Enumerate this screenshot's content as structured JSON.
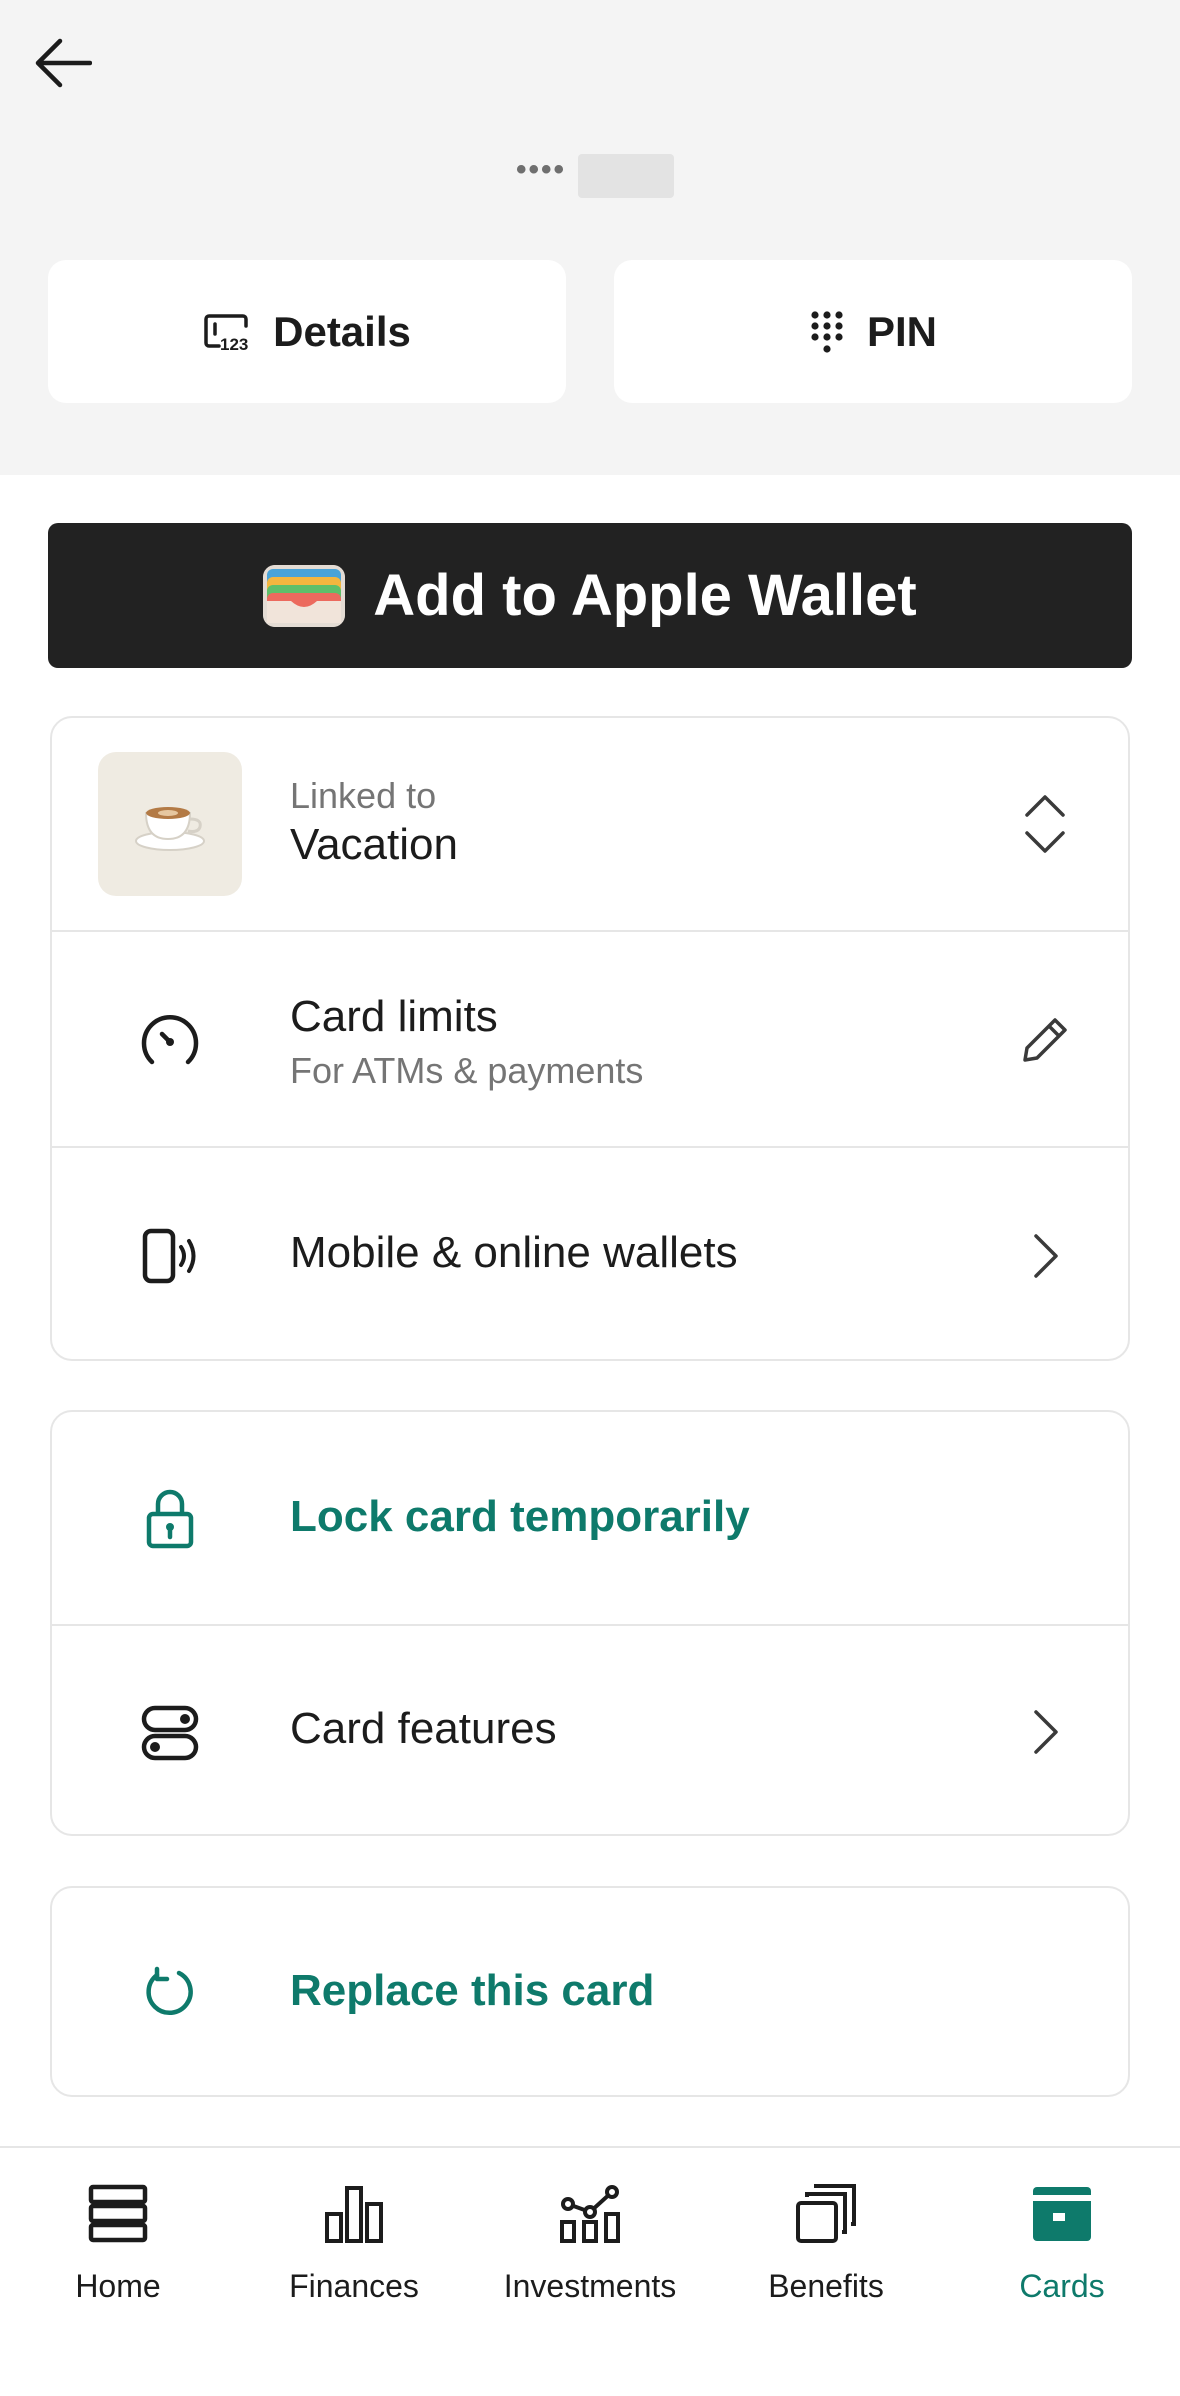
{
  "header": {
    "back_icon": "arrow-left-icon",
    "card_number_mask": "••••"
  },
  "actions": {
    "details_label": "Details",
    "details_icon": "card-details-icon",
    "pin_label": "PIN",
    "pin_icon": "keypad-icon"
  },
  "wallet": {
    "label": "Add to Apple Wallet",
    "icon": "apple-wallet-icon"
  },
  "card_settings": {
    "linked": {
      "caption": "Linked to",
      "account": "Vacation",
      "icon": "coffee-cup-image",
      "trailing_icon": "chevron-up-down-icon"
    },
    "limits": {
      "title": "Card limits",
      "subtitle": "For ATMs & payments",
      "icon": "speedometer-icon",
      "trailing_icon": "pencil-icon"
    },
    "wallets": {
      "title": "Mobile & online wallets",
      "icon": "phone-contactless-icon",
      "trailing_icon": "chevron-right-icon"
    }
  },
  "security": {
    "lock": {
      "title": "Lock card temporarily",
      "icon": "lock-icon"
    },
    "features": {
      "title": "Card features",
      "icon": "toggles-icon",
      "trailing_icon": "chevron-right-icon"
    }
  },
  "replace": {
    "title": "Replace this card",
    "icon": "refresh-icon"
  },
  "nav": {
    "items": [
      {
        "label": "Home",
        "icon": "home-icon",
        "active": false
      },
      {
        "label": "Finances",
        "icon": "bar-chart-icon",
        "active": false
      },
      {
        "label": "Investments",
        "icon": "investments-chart-icon",
        "active": false
      },
      {
        "label": "Benefits",
        "icon": "stacked-cards-icon",
        "active": false
      },
      {
        "label": "Cards",
        "icon": "card-icon",
        "active": true
      }
    ]
  },
  "colors": {
    "accent": "#0e7a6b",
    "header_bg": "#f4f4f4",
    "wallet_button_bg": "#222222",
    "border": "#e6e6e6"
  }
}
